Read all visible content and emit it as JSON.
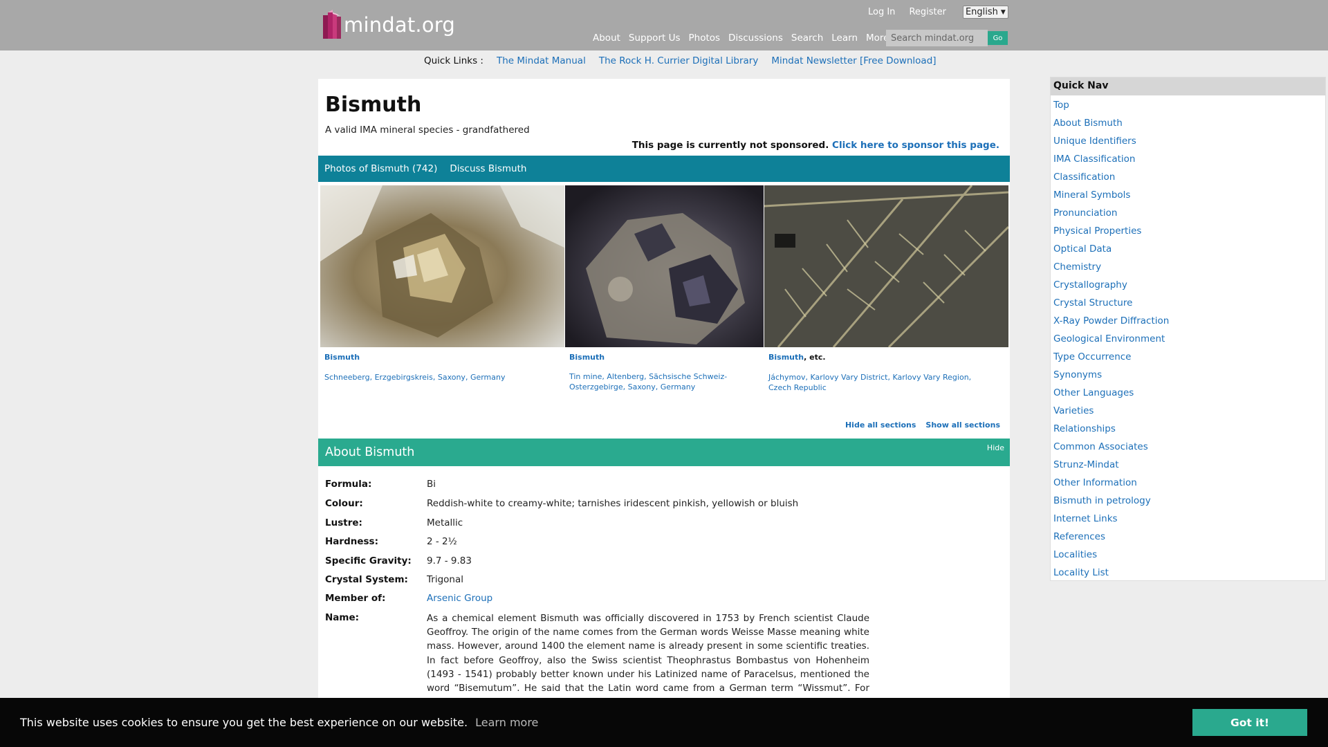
{
  "header": {
    "logo_text": "mindat.org",
    "auth": {
      "login": "Log In",
      "register": "Register",
      "language": "English"
    },
    "nav": [
      "About",
      "Support Us",
      "Photos",
      "Discussions",
      "Search",
      "Learn",
      "More"
    ],
    "search": {
      "placeholder": "Search mindat.org",
      "go": "Go"
    }
  },
  "quicklinks": {
    "label": "Quick Links :",
    "links": [
      "The Mindat Manual",
      "The Rock H. Currier Digital Library",
      "Mindat Newsletter [Free Download]"
    ]
  },
  "mineral": {
    "title": "Bismuth",
    "subtitle": "A valid IMA mineral species - grandfathered",
    "sponsor_text": "This page is currently not sponsored.",
    "sponsor_link": "Click here to sponsor this page.",
    "tabs": [
      "Photos of Bismuth (742)",
      "Discuss Bismuth"
    ]
  },
  "photos": [
    {
      "title": "Bismuth",
      "extra": "",
      "location": "Schneeberg, Erzgebirgskreis, Saxony, Germany"
    },
    {
      "title": "Bismuth",
      "extra": "",
      "location": "Tin mine, Altenberg, Sächsische Schweiz-Osterzgebirge, Saxony, Germany"
    },
    {
      "title": "Bismuth",
      "extra": ", etc.",
      "location": "Jáchymov, Karlovy Vary District, Karlovy Vary Region, Czech Republic"
    }
  ],
  "sections": {
    "hide_all": "Hide all sections",
    "show_all": "Show all sections"
  },
  "about": {
    "title": "About Bismuth",
    "hide": "Hide",
    "properties": [
      {
        "label": "Formula:",
        "value": "Bi"
      },
      {
        "label": "Colour:",
        "value": "Reddish-white to creamy-white; tarnishes iridescent pinkish, yellowish or bluish"
      },
      {
        "label": "Lustre:",
        "value": "Metallic"
      },
      {
        "label": "Hardness:",
        "value": "2 - 2½"
      },
      {
        "label": "Specific Gravity:",
        "value": "9.7 - 9.83"
      },
      {
        "label": "Crystal System:",
        "value": "Trigonal"
      },
      {
        "label": "Member of:",
        "value": "Arsenic Group"
      }
    ],
    "name_label": "Name:",
    "name_text": "As a chemical element Bismuth was officially discovered in 1753 by French scientist Claude Geoffroy. The origin of the name comes from the German words Weisse Masse meaning white mass. However, around 1400 the element name is already present in some scientific treaties. In fact before Geoffroy, also the Swiss scientist Theophrastus Bombastus von Hohenheim (1493 - 1541) probably better known under his Latinized name of Paracelsus, mentioned the word “Bisemutum”. He said that the Latin word came from a German term “Wissmut”. For him, the word “wissmut” was because in Saxony,"
  },
  "quicknav": {
    "title": "Quick Nav",
    "items": [
      "Top",
      "About Bismuth",
      "Unique Identifiers",
      "IMA Classification",
      "Classification",
      "Mineral Symbols",
      "Pronunciation",
      "Physical Properties",
      "Optical Data",
      "Chemistry",
      "Crystallography",
      "Crystal Structure",
      "X-Ray Powder Diffraction",
      "Geological Environment",
      "Type Occurrence",
      "Synonyms",
      "Other Languages",
      "Varieties",
      "Relationships",
      "Common Associates",
      "Strunz-Mindat",
      "Other Information",
      "Bismuth in petrology",
      "Internet Links",
      "References",
      "Localities",
      "Locality List"
    ]
  },
  "cookie": {
    "message": "This website uses cookies to ensure you get the best experience on our website.",
    "learn_more": "Learn more",
    "button": "Got it!"
  }
}
